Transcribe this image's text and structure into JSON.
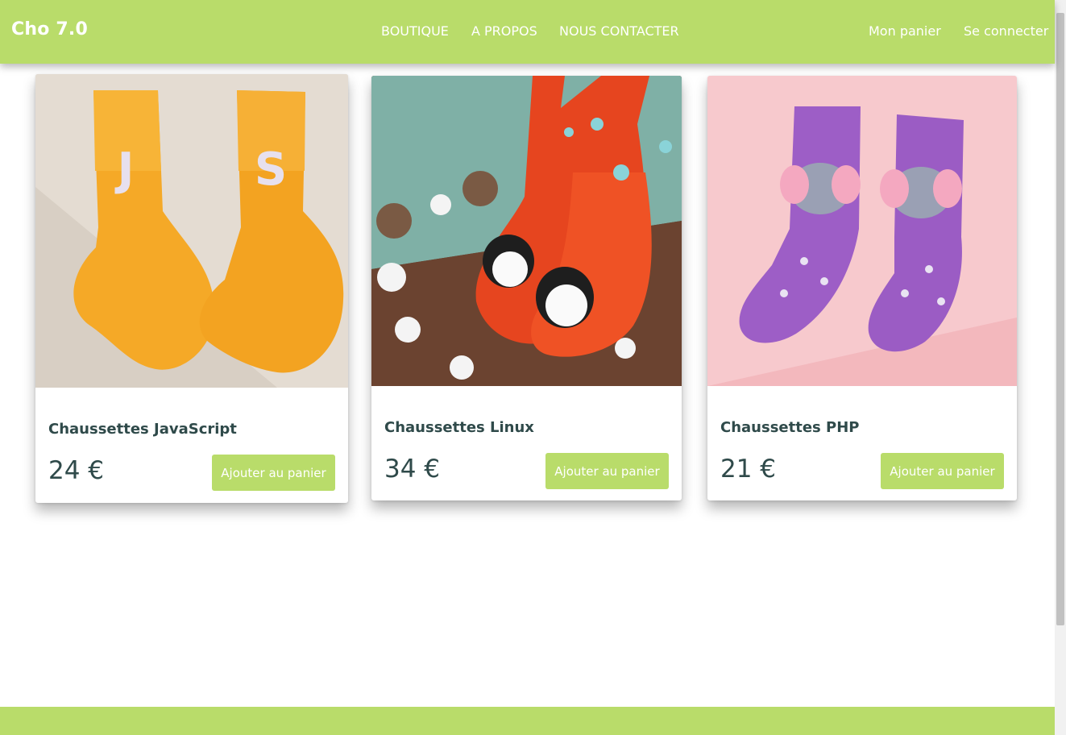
{
  "brand": "Cho 7.0",
  "nav": {
    "boutique": "BOUTIQUE",
    "apropos": "A PROPOS",
    "contact": "NOUS CONTACTER",
    "cart": "Mon panier",
    "login": "Se connecter"
  },
  "products": [
    {
      "title": "Chaussettes JavaScript",
      "price": "24 €",
      "button": "Ajouter au panier",
      "image": "yellow-js-socks-photo"
    },
    {
      "title": "Chaussettes Linux",
      "price": "34 €",
      "button": "Ajouter au panier",
      "image": "orange-penguin-socks-photo"
    },
    {
      "title": "Chaussettes PHP",
      "price": "21 €",
      "button": "Ajouter au panier",
      "image": "purple-elephant-socks-photo"
    }
  ],
  "colors": {
    "accent": "#b9dc6a",
    "text_dark": "#2f4a4a"
  }
}
